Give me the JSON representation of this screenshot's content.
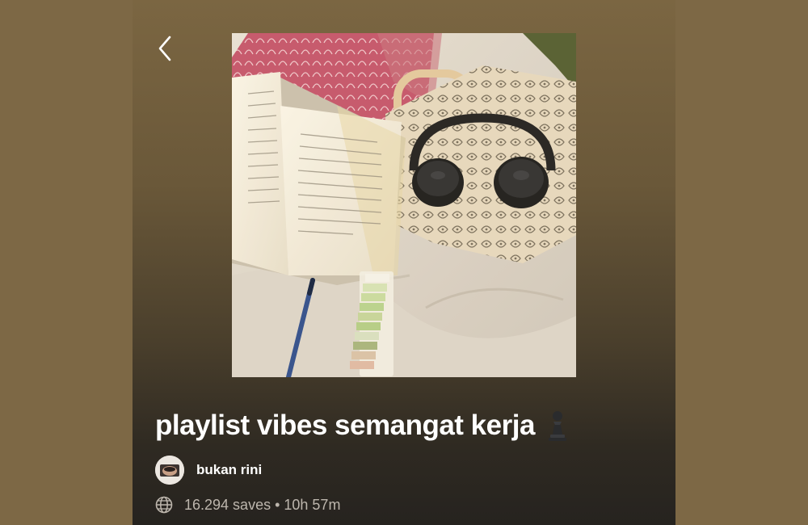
{
  "playlist": {
    "title": "playlist vibes semangat kerja",
    "title_emoji": "chess-pawn",
    "cover_image": "flat-lay photo of open book, black headphones on floral tote bag, pen and sticky tabs on white blanket",
    "owner": {
      "name": "bukan rini",
      "avatar": "profile photo"
    },
    "saves": "16.294 saves",
    "separator": "•",
    "duration": "10h 57m",
    "visibility_icon": "globe-icon"
  },
  "nav": {
    "back_icon": "chevron-left-icon"
  },
  "colors": {
    "background": "#7d6845",
    "gradient_bottom": "#26231f",
    "title": "#ffffff",
    "meta": "#bdb6ad"
  }
}
